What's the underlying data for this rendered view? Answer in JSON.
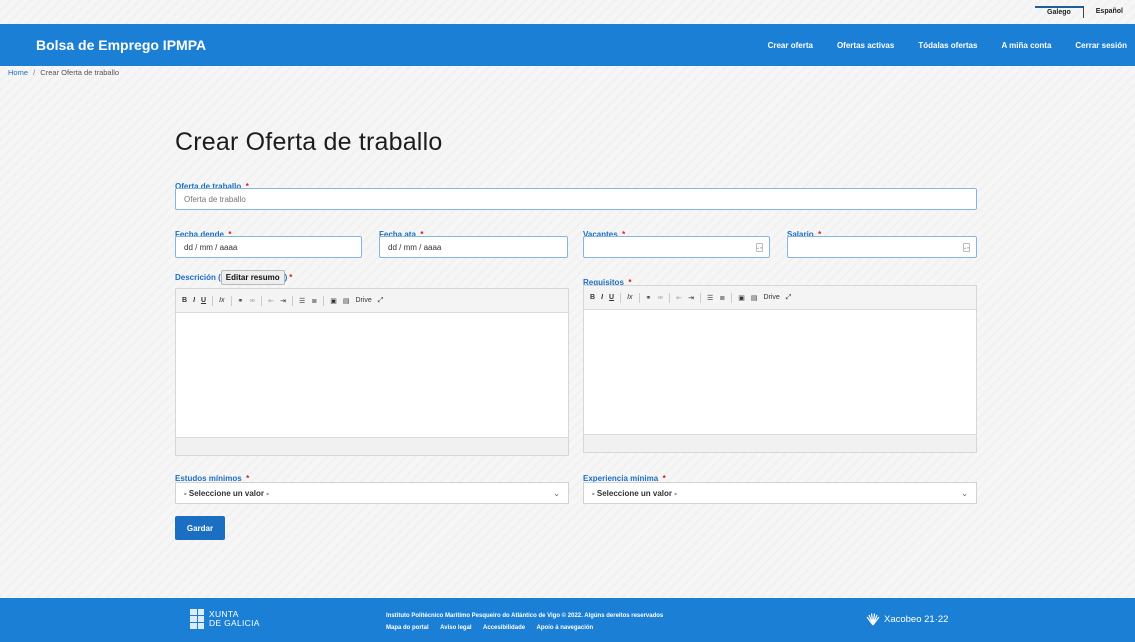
{
  "lang_bar": {
    "active": "Galego",
    "other": "Español"
  },
  "navbar": {
    "brand": "Bolsa de Emprego IPMPA",
    "links": [
      "Crear oferta",
      "Ofertas activas",
      "Tódalas ofertas",
      "A miña conta",
      "Cerrar sesión"
    ]
  },
  "breadcrumb": {
    "home": "Home",
    "separator": "/",
    "current": "Crear Oferta de traballo"
  },
  "form": {
    "title": "Crear Oferta de traballo",
    "required_mark": "*",
    "oferta": {
      "label": "Oferta de traballo",
      "placeholder": "Oferta de traballo"
    },
    "fecha_dende": {
      "label": "Fecha dende",
      "value": "dd / mm / aaaa"
    },
    "fecha_ata": {
      "label": "Fecha ata",
      "value": "dd / mm / aaaa"
    },
    "vacantes": {
      "label": "Vacantes",
      "value": ""
    },
    "salario": {
      "label": "Salario",
      "value": ""
    },
    "descricion": {
      "label": "Descrición (",
      "label_close": ")",
      "tooltip": "Editar resumo"
    },
    "requisitos": {
      "label": "Requisitos"
    },
    "toolbar": {
      "bold": "B",
      "italic": "I",
      "underline": "U",
      "clear": "Ix",
      "drive": "Drive"
    },
    "estudos": {
      "label": "Estudos mínimos",
      "value": "- Seleccione un valor -"
    },
    "experiencia": {
      "label": "Experiencia mínima",
      "value": "- Seleccione un valor -"
    },
    "submit": "Gardar"
  },
  "footer": {
    "xunta_line1": "XUNTA",
    "xunta_line2": "DE GALICIA",
    "copyright": "Instituto Politécnico Marítimo Pesqueiro do Atlántico de Vigo © 2022. Algúns dereitos reservados",
    "links": [
      "Mapa do portal",
      "Aviso legal",
      "Accesibilidade",
      "Apoio á navegación"
    ],
    "xacobeo": "Xacobeo 21·22"
  },
  "colors": {
    "brand": "#1b7fd6",
    "label": "#1b6fc2",
    "required": "#d21a1a"
  }
}
